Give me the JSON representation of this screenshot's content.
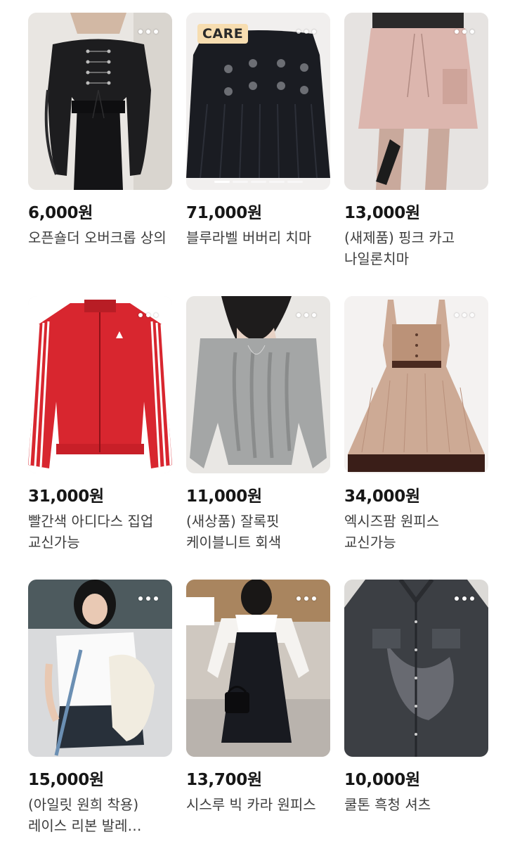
{
  "products": [
    {
      "price": "6,000원",
      "title": "오픈숄더 오버크롭 상의"
    },
    {
      "price": "71,000원",
      "title": "블루라벨 버버리 치마",
      "badge": "CARE"
    },
    {
      "price": "13,000원",
      "title": "(새제품) 핑크 카고 나일론치마"
    },
    {
      "price": "31,000원",
      "title": "빨간색 아디다스 집업 교신가능"
    },
    {
      "price": "11,000원",
      "title": "(새상품) 잘록핏 케이블니트 회색"
    },
    {
      "price": "34,000원",
      "title": "엑시즈팜 원피스 교신가능"
    },
    {
      "price": "15,000원",
      "title": "(아일릿 원희 착용) 레이스 리본 발레…"
    },
    {
      "price": "13,700원",
      "title": "시스루 빅 카라 원피스"
    },
    {
      "price": "10,000원",
      "title": "쿨톤 흑청 셔츠"
    }
  ],
  "icons": {
    "more": "more-options-icon"
  },
  "colors": {
    "badge_bg": "#f7ddb0",
    "price": "#161616",
    "title": "#3d3d3d"
  }
}
